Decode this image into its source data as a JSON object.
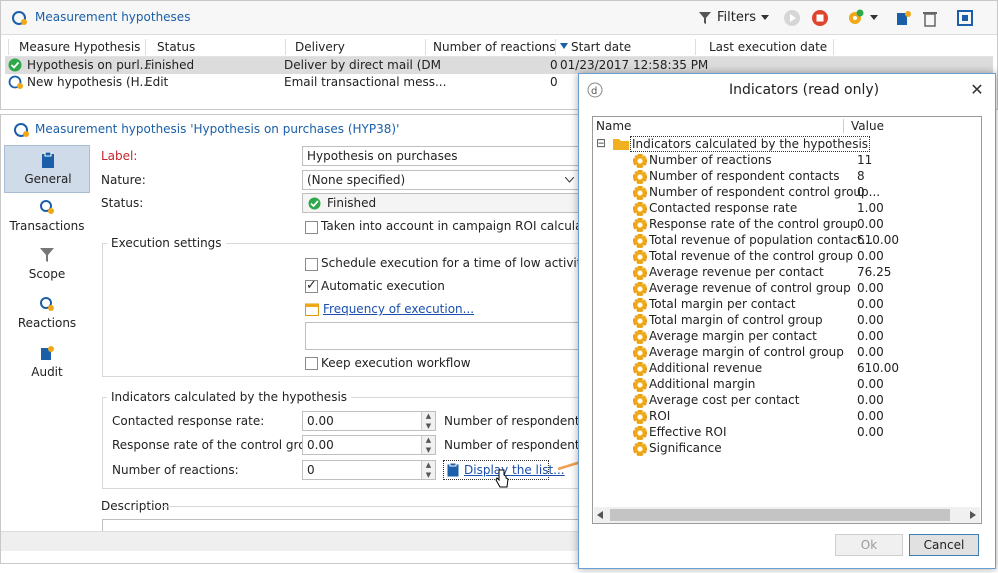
{
  "top": {
    "title": "Measurement hypotheses",
    "filters_label": "Filters",
    "columns": [
      "Measure Hypothesis",
      "Status",
      "Delivery",
      "Number of reactions",
      "Start date",
      "Last execution date"
    ],
    "rows": [
      {
        "name": "Hypothesis on purl...",
        "status": "Finished",
        "delivery": "Deliver by direct mail (DM",
        "reactions": "0",
        "start": "01/23/2017 12:58:35 PM",
        "last": ""
      },
      {
        "name": "New hypothesis (H...",
        "status": "Edit",
        "delivery": "Email transactional mess...",
        "reactions": "0",
        "start": "",
        "last": ""
      }
    ]
  },
  "detail": {
    "title": "Measurement hypothesis 'Hypothesis on purchases (HYP38)'",
    "sidebar": [
      {
        "label": "General",
        "icon": "clipboard-icon"
      },
      {
        "label": "Transactions",
        "icon": "transactions-icon"
      },
      {
        "label": "Scope",
        "icon": "funnel-icon"
      },
      {
        "label": "Reactions",
        "icon": "reactions-icon"
      },
      {
        "label": "Audit",
        "icon": "audit-icon"
      }
    ],
    "label_label": "Label:",
    "label_value": "Hypothesis on purchases",
    "nature_label": "Nature:",
    "nature_value": "(None specified)",
    "status_label": "Status:",
    "status_value": "Finished",
    "roi_check": "Taken into account in campaign ROI calculation",
    "exec_group": "Execution settings",
    "schedule_check": "Schedule execution for a time of low activity",
    "auto_check": "Automatic execution",
    "frequency_link": "Frequency of execution...",
    "keep_check": "Keep execution workflow",
    "indicators_group": "Indicators calculated by the hypothesis",
    "ind_rows": [
      {
        "label": "Contacted response rate:",
        "value": "0.00",
        "right": "Number of respondent co"
      },
      {
        "label": "Response rate of the control group:",
        "value": "0.00",
        "right": "Number of respondent co"
      },
      {
        "label": "Number of reactions:",
        "value": "0",
        "right": ""
      }
    ],
    "display_list_link": "Display the list...",
    "description_label": "Description"
  },
  "dialog": {
    "title": "Indicators (read only)",
    "close": "✕",
    "col_name": "Name",
    "col_value": "Value",
    "root_toggle": "⊟",
    "root": "Indicators calculated by the hypothesis",
    "items": [
      {
        "name": "Number of reactions",
        "value": "11"
      },
      {
        "name": "Number of respondent contacts",
        "value": "8"
      },
      {
        "name": "Number of respondent control group...",
        "value": "0"
      },
      {
        "name": "Contacted response rate",
        "value": "1.00"
      },
      {
        "name": "Response rate of the control group",
        "value": "0.00"
      },
      {
        "name": "Total revenue of population contact...",
        "value": "610.00"
      },
      {
        "name": "Total revenue of the control group",
        "value": "0.00"
      },
      {
        "name": "Average revenue per contact",
        "value": "76.25"
      },
      {
        "name": "Average revenue of control group",
        "value": "0.00"
      },
      {
        "name": "Total margin per contact",
        "value": "0.00"
      },
      {
        "name": "Total margin of control group",
        "value": "0.00"
      },
      {
        "name": "Average margin per contact",
        "value": "0.00"
      },
      {
        "name": "Average margin of control group",
        "value": "0.00"
      },
      {
        "name": "Additional revenue",
        "value": "610.00"
      },
      {
        "name": "Additional margin",
        "value": "0.00"
      },
      {
        "name": "Average cost per contact",
        "value": "0.00"
      },
      {
        "name": "ROI",
        "value": "0.00"
      },
      {
        "name": "Effective ROI",
        "value": "0.00"
      },
      {
        "name": "Significance",
        "value": ""
      }
    ],
    "ok": "Ok",
    "cancel": "Cancel"
  },
  "colors": {
    "accent": "#1a5fa8",
    "status_green": "#2ea84a",
    "arrow": "#f0a050"
  }
}
